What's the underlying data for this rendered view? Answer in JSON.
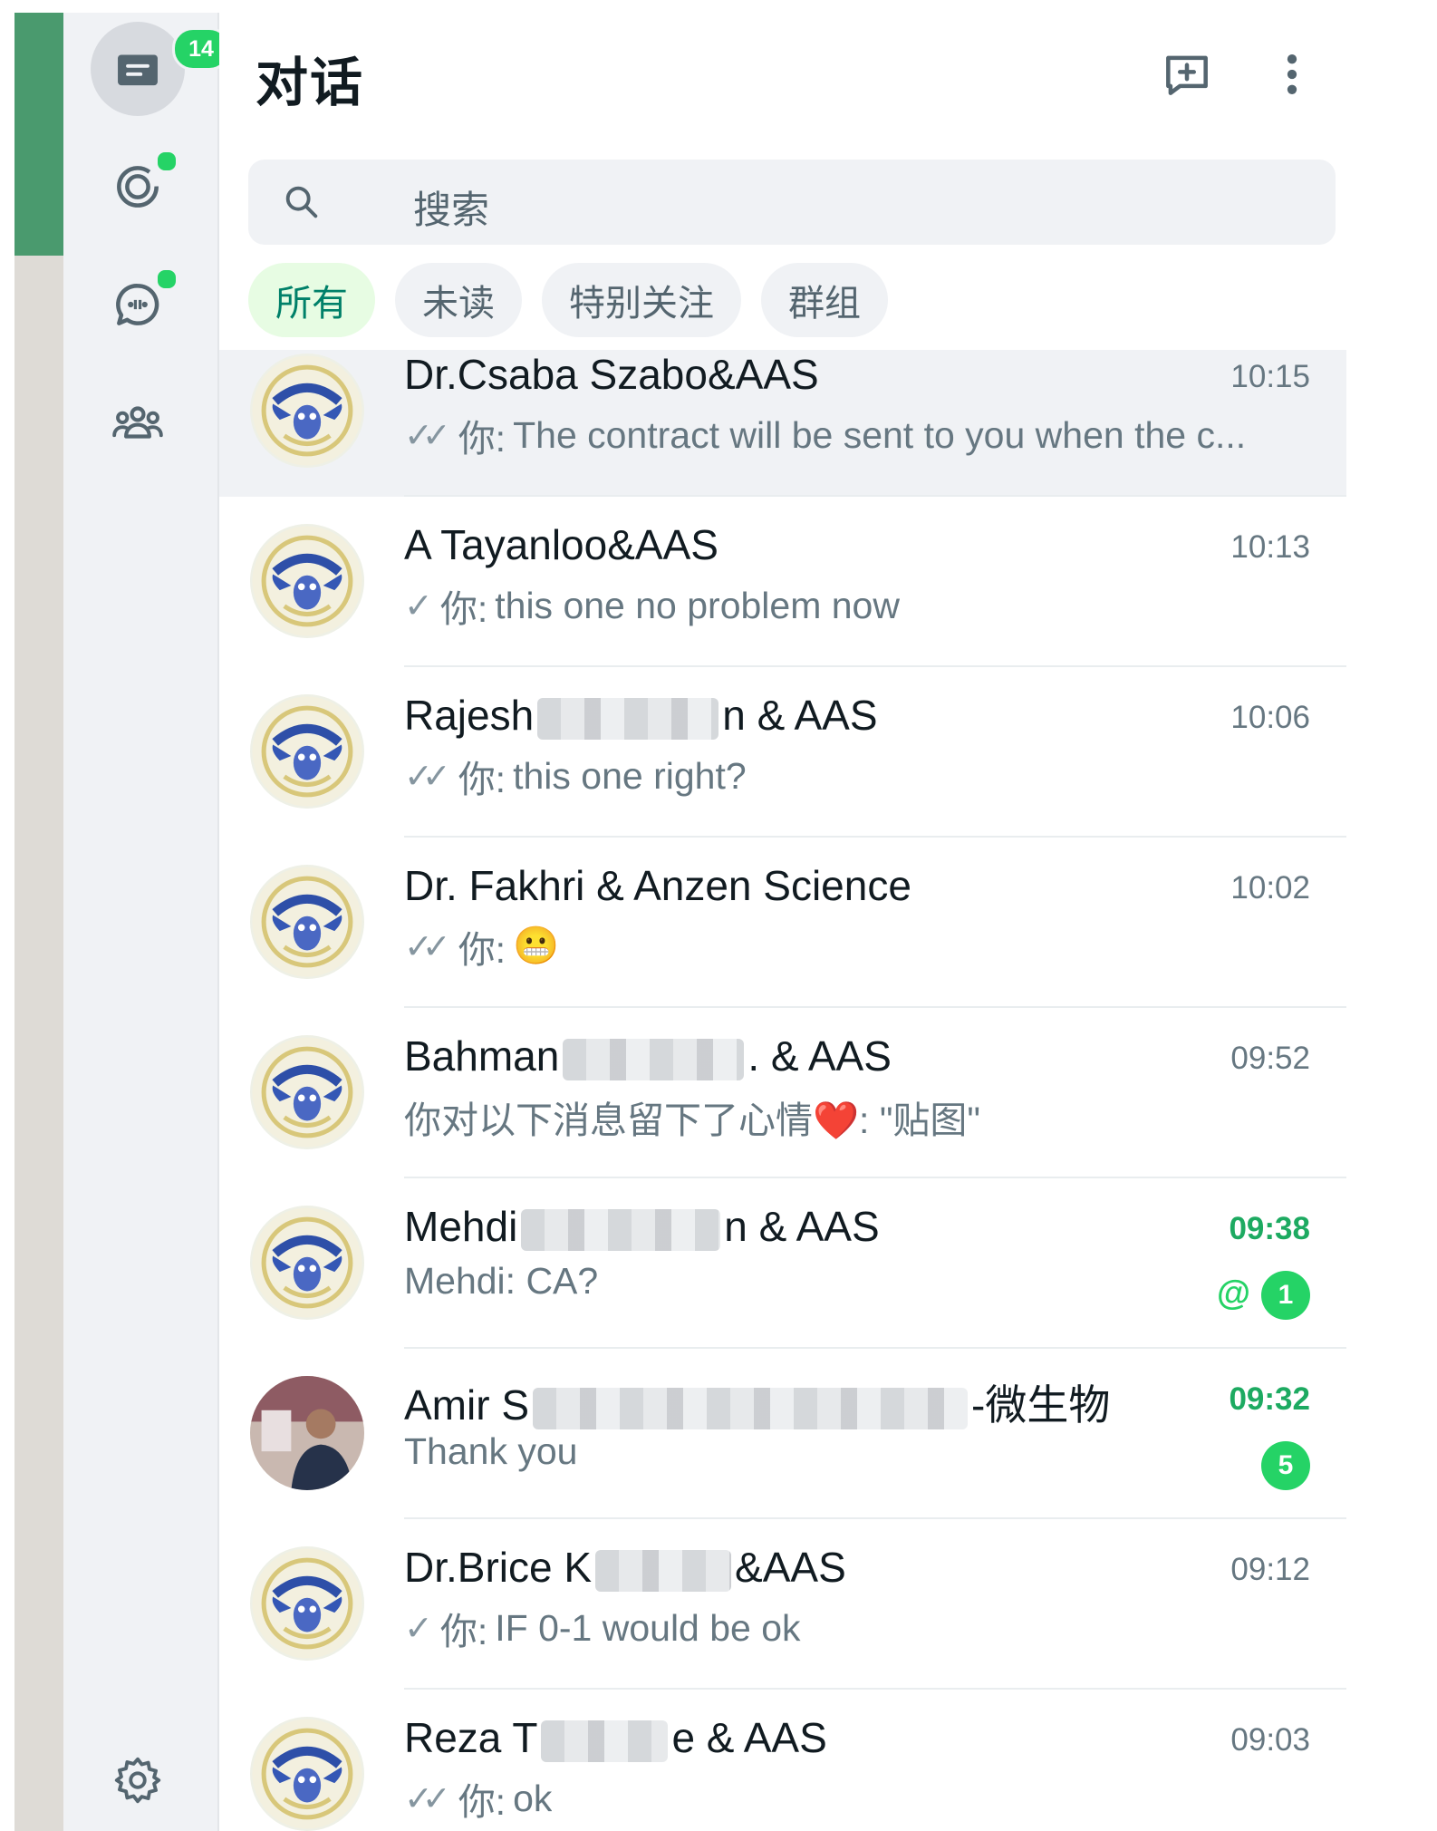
{
  "nav": {
    "chats_badge": "14",
    "items": [
      {
        "icon": "chats-icon",
        "active": true
      },
      {
        "icon": "status-icon",
        "dot": true
      },
      {
        "icon": "channels-icon",
        "dot": true
      },
      {
        "icon": "communities-icon"
      }
    ],
    "settings_icon": "gear-icon"
  },
  "header": {
    "title": "对话",
    "new_chat_icon": "new-chat-icon",
    "menu_icon": "kebab-menu-icon"
  },
  "search": {
    "placeholder": "搜索"
  },
  "filters": [
    "所有",
    "未读",
    "特别关注",
    "群组"
  ],
  "colors": {
    "accent": "#25d366",
    "brand": "#008069",
    "rail_strip": "#4a9a6e"
  },
  "chats": [
    {
      "name": "Dr.Csaba Szabo&AAS",
      "time": "10:15",
      "tick": "double",
      "sender": "你:",
      "message": "The contract will be sent to you when the c...",
      "selected": true
    },
    {
      "name": "A Tayanloo&AAS",
      "time": "10:13",
      "tick": "single",
      "sender": "你:",
      "message": "this one no problem now"
    },
    {
      "name_start": "Rajesh",
      "name_end": "n & AAS",
      "time": "10:06",
      "tick": "double",
      "sender": "你:",
      "message": "this one right?"
    },
    {
      "name": "Dr. Fakhri & Anzen Science",
      "time": "10:02",
      "tick": "double",
      "sender": "你:",
      "message": "😬"
    },
    {
      "name_start": "Bahman",
      "name_end": ". & AAS",
      "time": "09:52",
      "message": "你对以下消息留下了心情❤️:  \"贴图\""
    },
    {
      "name_start": "Mehdi",
      "name_end": "n & AAS",
      "time": "09:38",
      "message": "Mehdi: CA?",
      "unread": "1",
      "mention": "@"
    },
    {
      "name_start": "Amir S",
      "name_end": "-微生物",
      "time": "09:32",
      "message": "Thank you",
      "unread": "5"
    },
    {
      "name_start": "Dr.Brice K",
      "name_end": "&AAS",
      "time": "09:12",
      "tick": "single",
      "sender": "你:",
      "message": "IF 0-1 would be ok"
    },
    {
      "name_start": "Reza T",
      "name_end": "e & AAS",
      "time": "09:03",
      "tick": "double",
      "sender": "你:",
      "message": "ok"
    }
  ]
}
